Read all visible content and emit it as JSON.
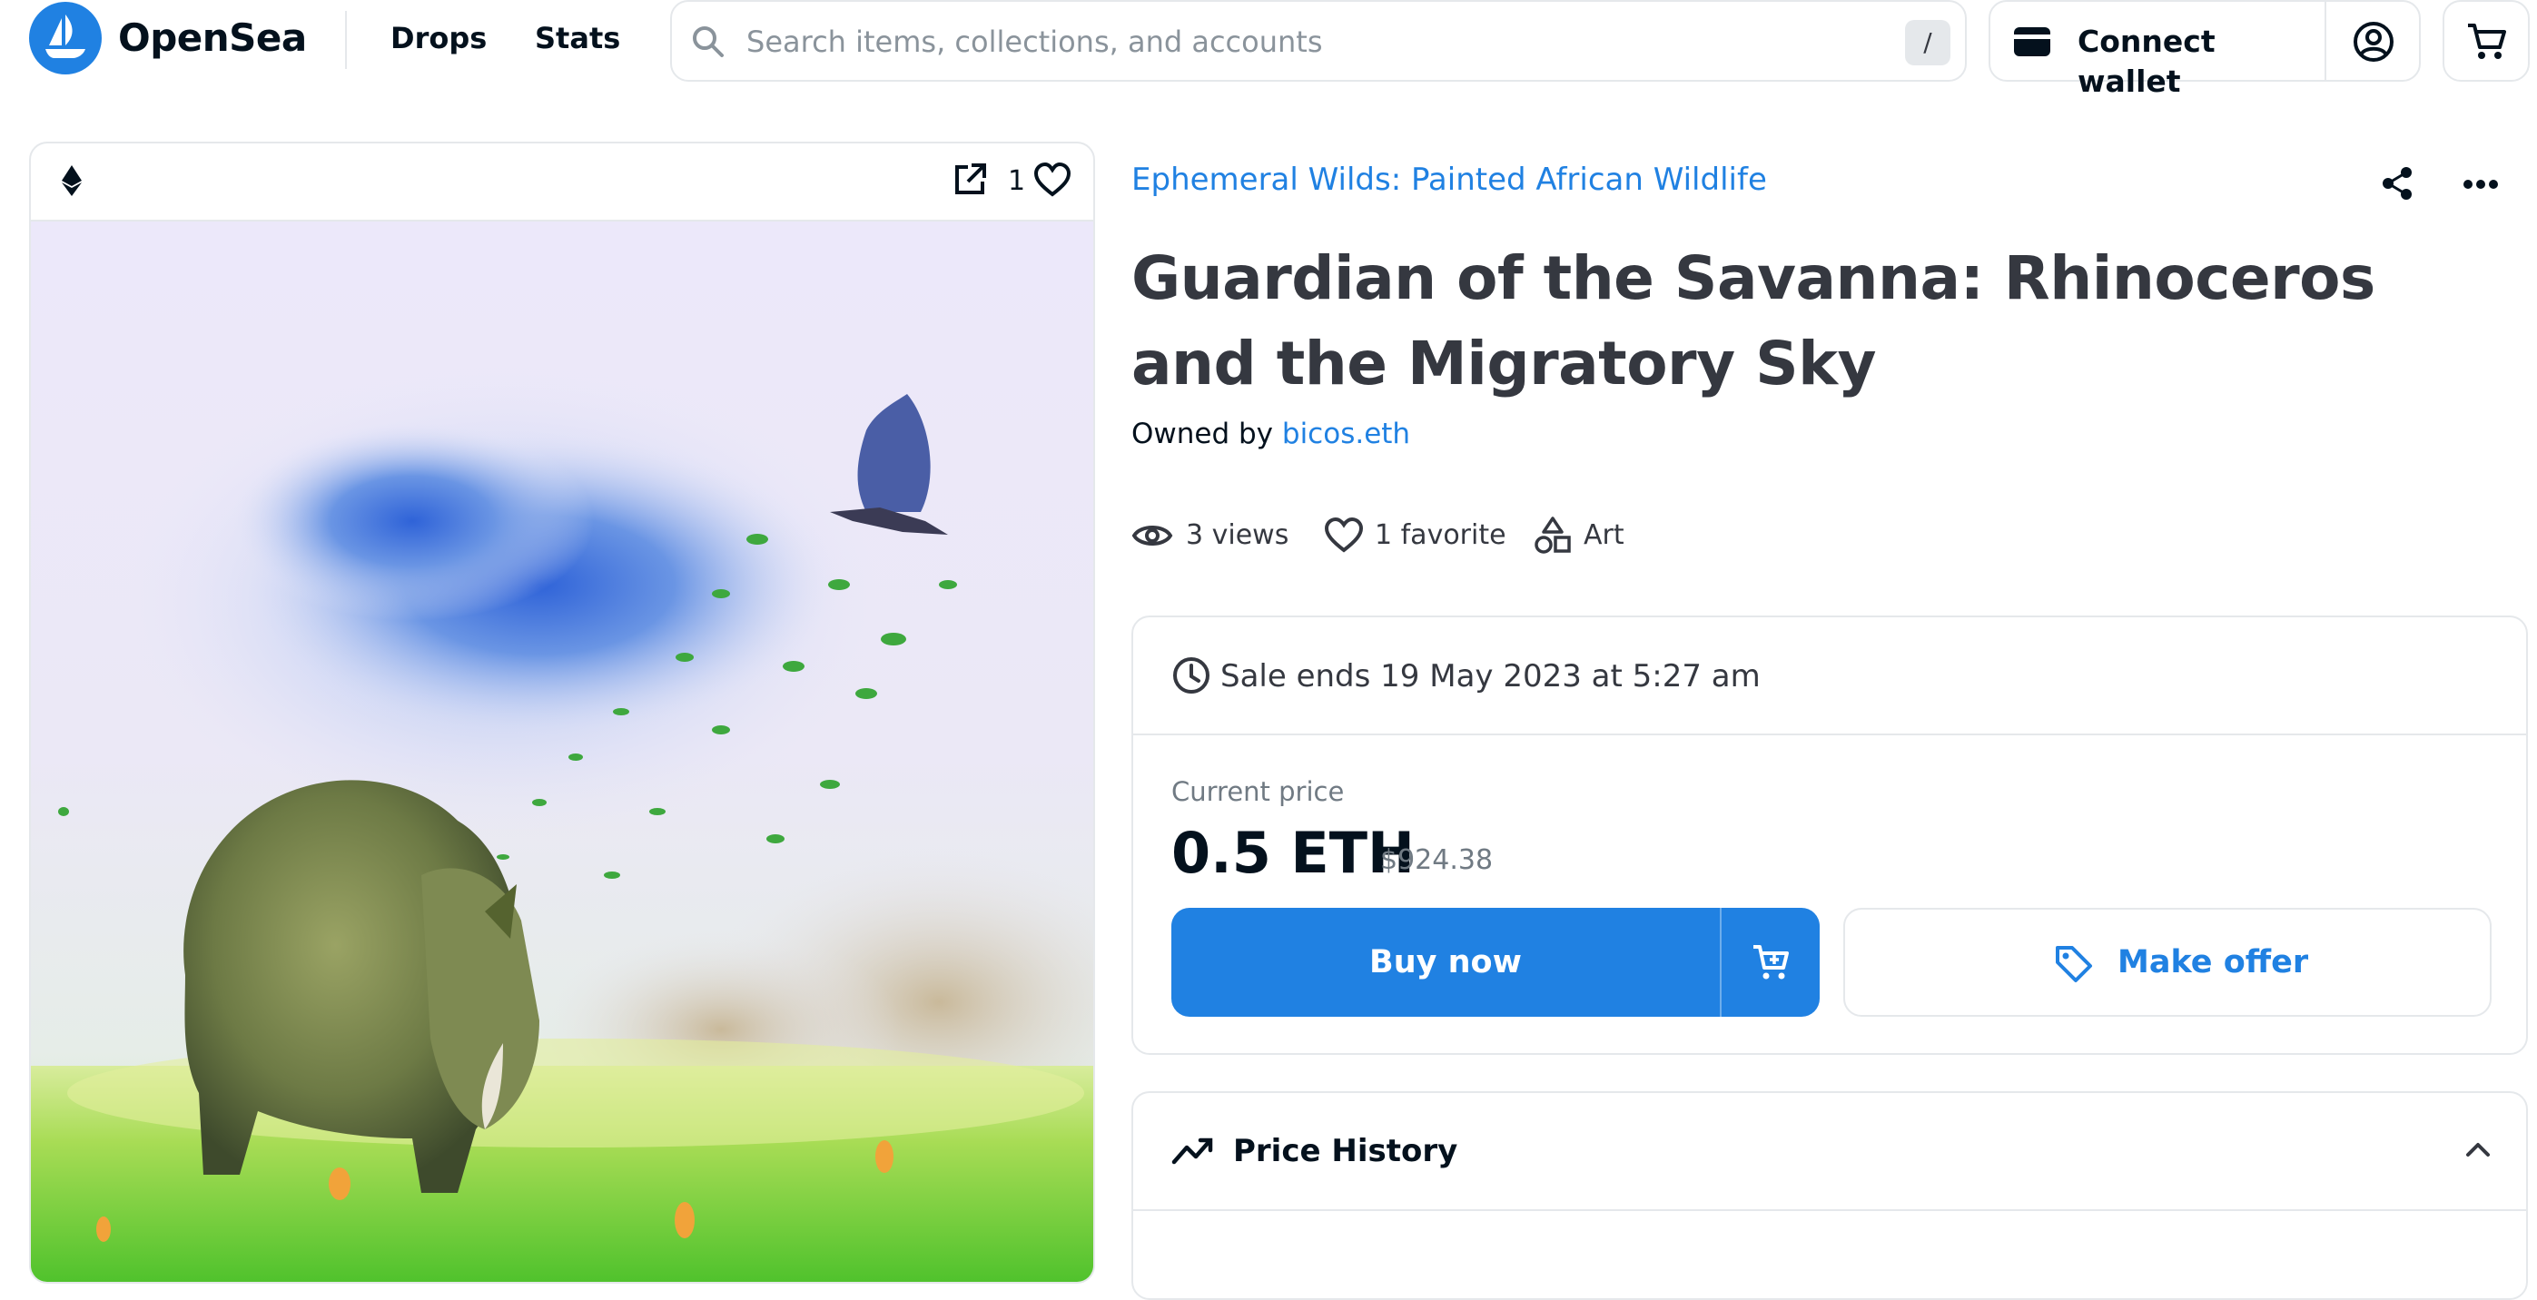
{
  "header": {
    "brand": "OpenSea",
    "nav": {
      "drops": "Drops",
      "stats": "Stats"
    },
    "search": {
      "placeholder": "Search items, collections, and accounts",
      "shortcut": "/"
    },
    "connect_wallet": "Connect wallet"
  },
  "image_card": {
    "favorite_count": "1"
  },
  "item": {
    "collection": "Ephemeral Wilds: Painted African Wildlife",
    "title": "Guardian of the Savanna: Rhinoceros and the Migratory Sky",
    "owned_by_label": "Owned by",
    "owner": "bicos.eth",
    "stats": {
      "views": "3 views",
      "favorites": "1 favorite",
      "category": "Art"
    }
  },
  "sale": {
    "ends": "Sale ends 19 May 2023 at 5:27 am",
    "price_label": "Current price",
    "price": "0.5 ETH",
    "price_usd": "$924.38",
    "buy_now": "Buy now",
    "make_offer": "Make offer"
  },
  "price_history": {
    "title": "Price History"
  },
  "colors": {
    "brand_blue": "#2081e2",
    "text_dark": "#04111d",
    "text_body": "#353840",
    "text_muted": "#707a83",
    "border": "#e5e8eb"
  }
}
